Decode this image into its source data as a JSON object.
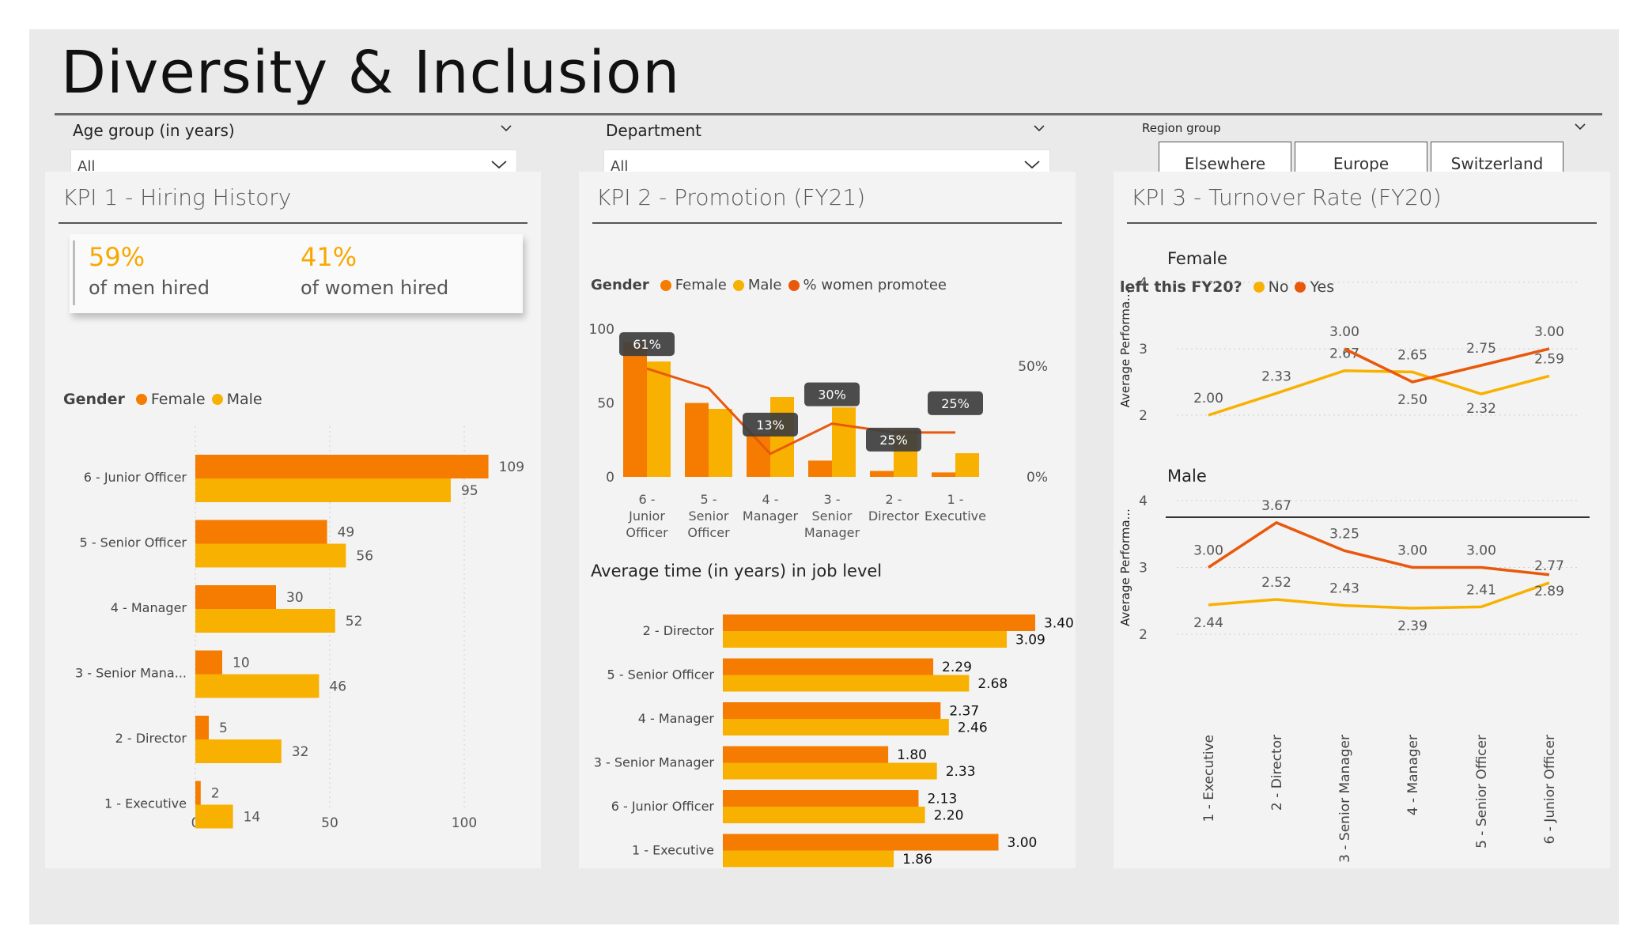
{
  "page": {
    "title": "Diversity & Inclusion"
  },
  "colors": {
    "female": "#f57c00",
    "male": "#f8b100",
    "promo": "#e8590c",
    "no": "#f8b100",
    "yes": "#e8590c"
  },
  "filters": {
    "age": {
      "label": "Age group (in years)",
      "value": "All"
    },
    "department": {
      "label": "Department",
      "value": "All"
    },
    "region": {
      "label": "Region group",
      "options": [
        "Elsewhere",
        "Europe",
        "Switzerland"
      ]
    }
  },
  "kpi1": {
    "title": "KPI 1 - Hiring History",
    "card": {
      "men_value": "59%",
      "men_label": "of men hired",
      "women_value": "41%",
      "women_label": "of women hired"
    },
    "legend": {
      "title": "Gender",
      "female": "Female",
      "male": "Male"
    },
    "chart_data": {
      "type": "bar",
      "orientation": "horizontal",
      "categories": [
        "6 - Junior Officer",
        "5 - Senior Officer",
        "4 - Manager",
        "3 - Senior Mana...",
        "2 - Director",
        "1 - Executive"
      ],
      "series": [
        {
          "name": "Female",
          "values": [
            109,
            49,
            30,
            10,
            5,
            2
          ]
        },
        {
          "name": "Male",
          "values": [
            95,
            56,
            52,
            46,
            32,
            14
          ]
        }
      ],
      "xlim": [
        0,
        110
      ],
      "xticks": [
        0,
        50,
        100
      ]
    }
  },
  "kpi2": {
    "title": "KPI 2 - Promotion (FY21)",
    "legend": {
      "title": "Gender",
      "female": "Female",
      "male": "Male",
      "promo": "% women promotee"
    },
    "promotion_chart": {
      "type": "bar",
      "categories": [
        [
          "6 -",
          "Junior",
          "Officer"
        ],
        [
          "5 -",
          "Senior",
          "Officer"
        ],
        [
          "4 -",
          "Manager"
        ],
        [
          "3 -",
          "Senior",
          "Manager"
        ],
        [
          "2 -",
          "Director"
        ],
        [
          "1 -",
          "Executive"
        ]
      ],
      "series": [
        {
          "name": "Female",
          "values": [
            91,
            50,
            29,
            11,
            4,
            3
          ]
        },
        {
          "name": "Male",
          "values": [
            78,
            46,
            54,
            47,
            32,
            16
          ]
        }
      ],
      "line": {
        "name": "% women promotee",
        "values": [
          61,
          50,
          13,
          30,
          25,
          25
        ],
        "labels": [
          "61%",
          "",
          "13%",
          "30%",
          "25%",
          "25%"
        ]
      },
      "ylim": [
        0,
        100
      ],
      "yticks": [
        0,
        50,
        100
      ],
      "y2lim": [
        0,
        100
      ],
      "y2ticks": [
        "0%",
        "50%"
      ]
    },
    "tenure_title": "Average time (in years) in job level",
    "tenure_chart": {
      "type": "bar",
      "orientation": "horizontal",
      "categories": [
        "2 - Director",
        "5 - Senior Officer",
        "4 - Manager",
        "3 - Senior Manager",
        "6 - Junior Officer",
        "1 - Executive"
      ],
      "series": [
        {
          "name": "Female",
          "values": [
            3.4,
            2.29,
            2.37,
            1.8,
            2.13,
            3.0
          ],
          "labels": [
            "3.40",
            "2.29",
            "2.37",
            "1.80",
            "2.13",
            "3.00"
          ]
        },
        {
          "name": "Male",
          "values": [
            3.09,
            2.68,
            2.46,
            2.33,
            2.2,
            1.86
          ],
          "labels": [
            "3.09",
            "2.68",
            "2.46",
            "2.33",
            "2.20",
            "1.86"
          ]
        }
      ],
      "xlim": [
        0,
        3.4
      ]
    }
  },
  "kpi3": {
    "title": "KPI 3 - Turnover Rate (FY20)",
    "legend": {
      "title": "left this FY20?",
      "no": "No",
      "yes": "Yes"
    },
    "chart_data": {
      "type": "line",
      "x": [
        "1 - Executive",
        "2 - Director",
        "3 - Senior Manager",
        "4 - Manager",
        "5 - Senior Officer",
        "6 - Junior Officer"
      ],
      "ylabel": "Average Performa...",
      "ylim": [
        2,
        4
      ],
      "yticks": [
        2,
        3,
        4
      ],
      "panels": [
        {
          "name": "Female",
          "series": [
            {
              "name": "No",
              "values": [
                2.0,
                2.33,
                2.67,
                2.65,
                2.32,
                2.59
              ],
              "labels": [
                "2.00",
                "2.33",
                "2.67",
                "2.65",
                "2.32",
                "2.59"
              ]
            },
            {
              "name": "Yes",
              "values": [
                null,
                null,
                3.0,
                2.5,
                2.75,
                3.0
              ],
              "labels": [
                "",
                "",
                "3.00",
                "2.50",
                "2.75",
                "3.00"
              ]
            }
          ]
        },
        {
          "name": "Male",
          "series": [
            {
              "name": "No",
              "values": [
                2.44,
                2.52,
                2.43,
                2.39,
                2.41,
                2.77
              ],
              "labels": [
                "2.44",
                "2.52",
                "2.43",
                "2.39",
                "2.41",
                "2.77"
              ]
            },
            {
              "name": "Yes",
              "values": [
                3.0,
                3.67,
                3.25,
                3.0,
                3.0,
                2.89
              ],
              "labels": [
                "3.00",
                "3.67",
                "3.25",
                "3.00",
                "3.00",
                "2.89"
              ]
            }
          ]
        }
      ]
    }
  }
}
